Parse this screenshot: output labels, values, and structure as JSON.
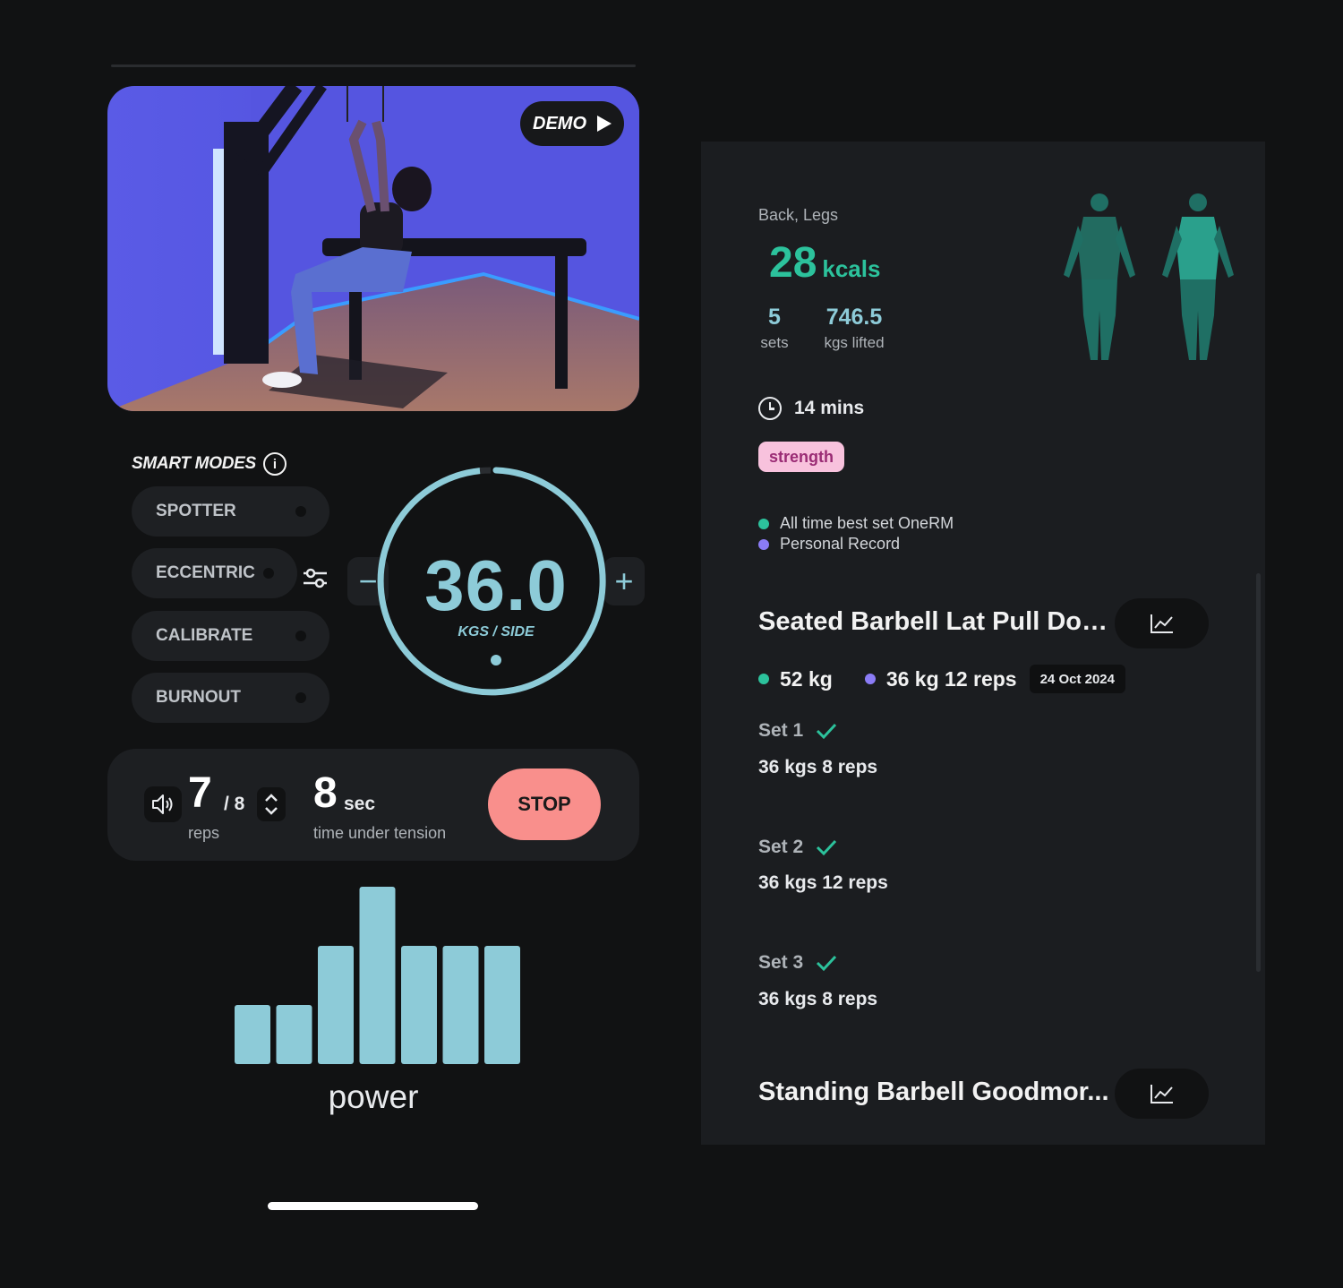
{
  "video": {
    "demo_label": "DEMO"
  },
  "smart_modes": {
    "title": "SMART MODES",
    "info_glyph": "i",
    "items": [
      "SPOTTER",
      "ECCENTRIC",
      "CALIBRATE",
      "BURNOUT"
    ]
  },
  "weight": {
    "value": "36.0",
    "unit": "KGS / SIDE",
    "minus": "−",
    "plus": "+"
  },
  "reps": {
    "count": "7",
    "total": "/ 8",
    "label": "reps"
  },
  "tension": {
    "value": "8",
    "unit": "sec",
    "label": "time under tension"
  },
  "stop_label": "STOP",
  "power": {
    "label": "power",
    "chart_data": {
      "type": "bar",
      "values": [
        2,
        2,
        4,
        6,
        4,
        4,
        4
      ],
      "ylim": [
        0,
        6
      ]
    }
  },
  "summary": {
    "muscles": "Back, Legs",
    "kcals_value": "28",
    "kcals_unit": "kcals",
    "sets_value": "5",
    "sets_label": "sets",
    "kgs_value": "746.5",
    "kgs_label": "kgs lifted",
    "duration": "14 mins",
    "tag": "strength",
    "legend": [
      {
        "label": "All time best set OneRM",
        "color": "#2cc29c"
      },
      {
        "label": "Personal Record",
        "color": "#8b7cf6"
      }
    ]
  },
  "exercises": [
    {
      "title": "Seated Barbell Lat Pull Down",
      "best": "52 kg",
      "record": "36 kg 12 reps",
      "date": "24 Oct 2024",
      "sets": [
        {
          "label": "Set 1",
          "value": "36 kgs 8 reps"
        },
        {
          "label": "Set 2",
          "value": "36 kgs 12 reps"
        },
        {
          "label": "Set 3",
          "value": "36 kgs 8 reps"
        }
      ]
    },
    {
      "title": "Standing Barbell Goodmor..."
    }
  ],
  "colors": {
    "accent_teal": "#8dcbd8",
    "accent_green": "#2cc29c",
    "accent_purple": "#8b7cf6",
    "stop": "#f98f8c",
    "tag_bg": "#f8c2dd"
  },
  "icons": [
    "info-icon",
    "sliders-icon",
    "sound-icon",
    "stepper-icon",
    "clock-icon",
    "line-chart-icon",
    "check-icon",
    "play-icon"
  ]
}
